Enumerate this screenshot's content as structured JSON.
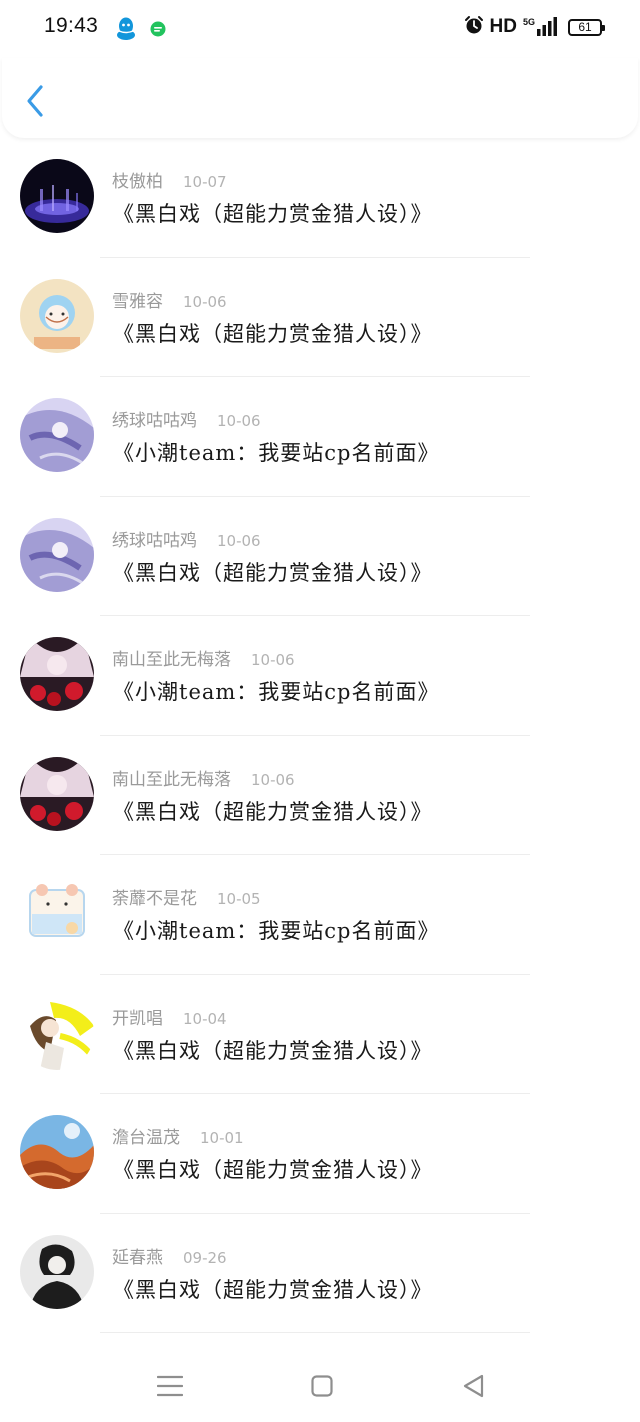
{
  "status_bar": {
    "time": "19:43",
    "network": "HD",
    "signal_type": "5G",
    "battery": "61",
    "icons": [
      "qq-icon",
      "wechat-icon",
      "alarm-icon",
      "signal-icon",
      "battery-icon"
    ]
  },
  "header": {
    "back_icon": "chevron-left-icon",
    "accent_color": "#3a9be6"
  },
  "items": [
    {
      "name": "枝傲柏",
      "date": "10-07",
      "title": "《黑白戏（超能力赏金猎人设）》"
    },
    {
      "name": "雪雅容",
      "date": "10-06",
      "title": "《黑白戏（超能力赏金猎人设）》"
    },
    {
      "name": "绣球咕咕鸡",
      "date": "10-06",
      "title": "《小潮team：我要站cp名前面》"
    },
    {
      "name": "绣球咕咕鸡",
      "date": "10-06",
      "title": "《黑白戏（超能力赏金猎人设）》"
    },
    {
      "name": "南山至此无梅落",
      "date": "10-06",
      "title": "《小潮team：我要站cp名前面》"
    },
    {
      "name": "南山至此无梅落",
      "date": "10-06",
      "title": "《黑白戏（超能力赏金猎人设）》"
    },
    {
      "name": "荼蘼不是花",
      "date": "10-05",
      "title": "《小潮team：我要站cp名前面》"
    },
    {
      "name": "开凯唱",
      "date": "10-04",
      "title": "《黑白戏（超能力赏金猎人设）》"
    },
    {
      "name": "澹台温茂",
      "date": "10-01",
      "title": "《黑白戏（超能力赏金猎人设）》"
    },
    {
      "name": "延春燕",
      "date": "09-26",
      "title": "《黑白戏（超能力赏金猎人设）》"
    }
  ],
  "nav_bar": {
    "icons": [
      "menu-icon",
      "home-icon",
      "back-icon"
    ]
  }
}
